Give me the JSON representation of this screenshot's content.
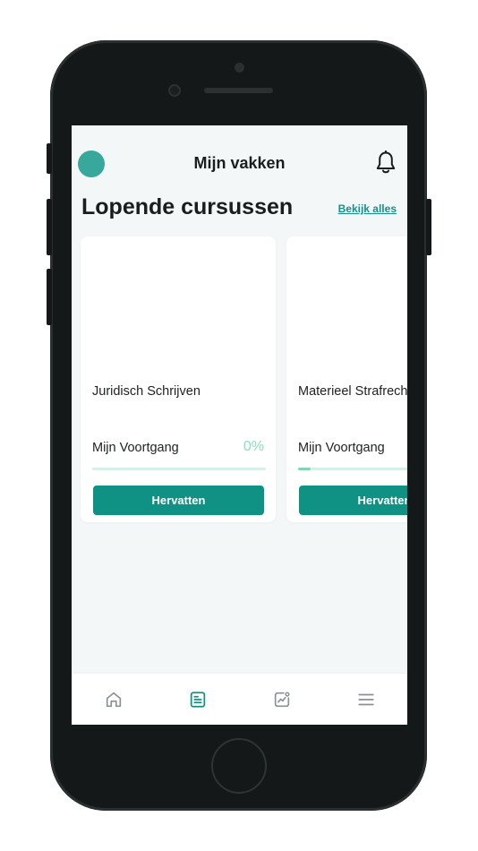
{
  "header": {
    "title": "Mijn vakken",
    "avatar_icon": "avatar-circle",
    "notification_icon": "bell-icon"
  },
  "section": {
    "title": "Lopende cursussen",
    "see_all": "Bekijk alles"
  },
  "courses": [
    {
      "name": "Juridisch Schrijven",
      "progress_label": "Mijn Voortgang",
      "progress_text": "0%",
      "progress": 0,
      "button": "Hervatten"
    },
    {
      "name": "Materieel Strafrecht",
      "progress_label": "Mijn Voortgang",
      "progress_text": "",
      "progress": 0.07,
      "button": "Hervatten"
    }
  ],
  "tabbar": {
    "items": [
      {
        "icon": "home-icon",
        "active": false
      },
      {
        "icon": "courses-icon",
        "active": true
      },
      {
        "icon": "stats-icon",
        "active": false
      },
      {
        "icon": "menu-icon",
        "active": false
      }
    ]
  },
  "colors": {
    "accent": "#0f9184",
    "avatar": "#38a79c",
    "progress": "#7fd8b0",
    "progress_text": "#8be0b7",
    "screen_bg": "#f4f7f8",
    "phone_body": "#141819"
  }
}
